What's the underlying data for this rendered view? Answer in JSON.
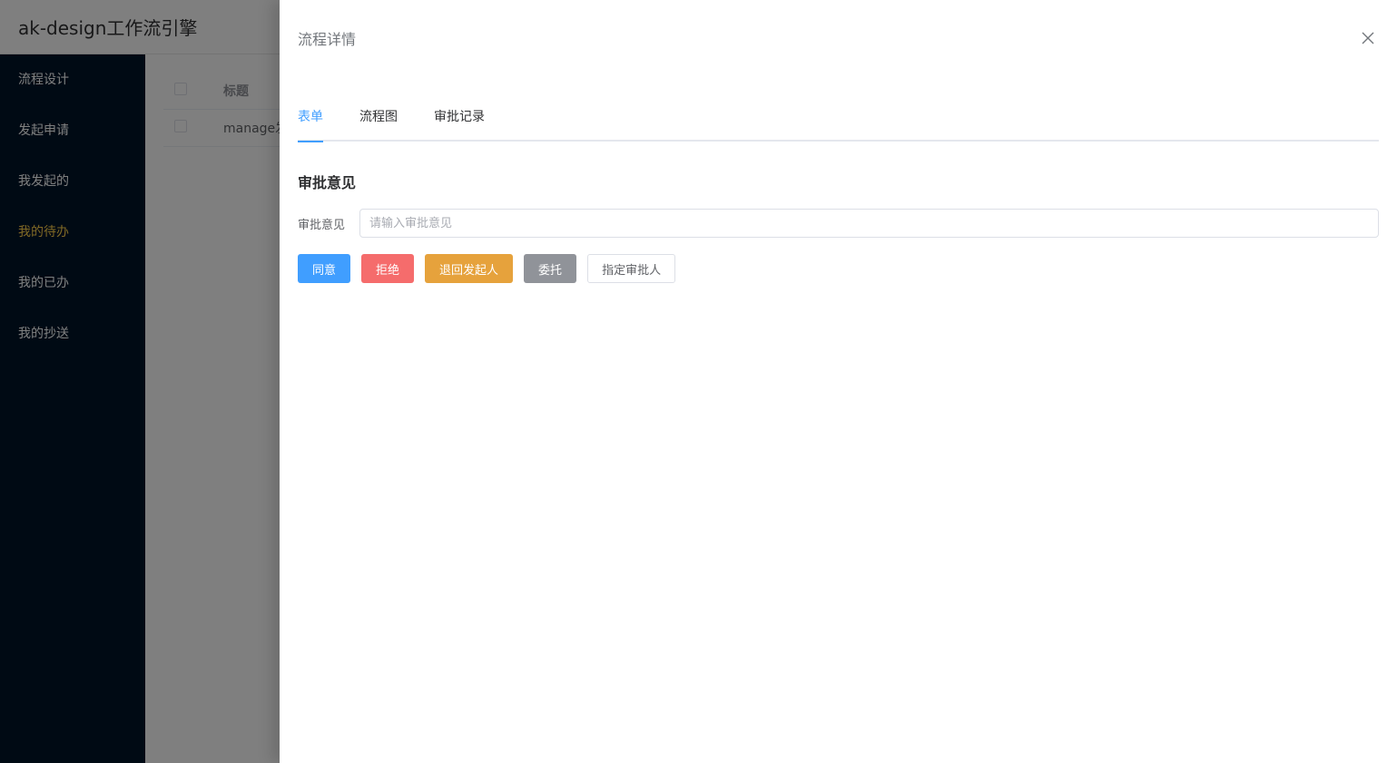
{
  "app": {
    "title": "ak-design工作流引擎"
  },
  "sidebar": {
    "items": [
      {
        "label": "流程设计"
      },
      {
        "label": "发起申请"
      },
      {
        "label": "我发起的"
      },
      {
        "label": "我的待办"
      },
      {
        "label": "我的已办"
      },
      {
        "label": "我的抄送"
      }
    ],
    "active_color": "#ffd04b",
    "bg_color": "#001529"
  },
  "table": {
    "header_title": "标题",
    "rows": [
      {
        "title": "manage发"
      }
    ]
  },
  "drawer": {
    "title": "流程详情",
    "close_icon": "close-icon",
    "tabs": [
      {
        "label": "表单"
      },
      {
        "label": "流程图"
      },
      {
        "label": "审批记录"
      }
    ],
    "section_title": "审批意见",
    "form": {
      "label": "审批意见",
      "placeholder": "请输入审批意见",
      "value": ""
    },
    "buttons": {
      "agree": "同意",
      "reject": "拒绝",
      "return": "退回发起人",
      "delegate": "委托",
      "assign": "指定审批人"
    },
    "accent_color": "#409eff"
  }
}
